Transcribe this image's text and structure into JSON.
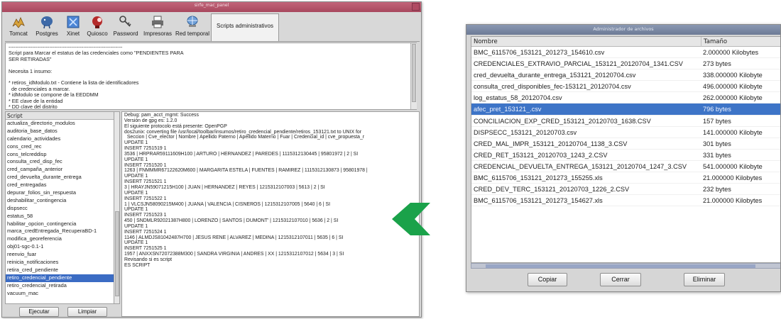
{
  "left_window": {
    "title": "sirfe_mac_panel",
    "tabs": [
      {
        "label": "Tomcat",
        "icon": "tomcat-icon"
      },
      {
        "label": "Postgres",
        "icon": "postgres-elephant-icon"
      },
      {
        "label": "Xinet",
        "icon": "xinet-icon"
      },
      {
        "label": "Quiosco",
        "icon": "quiosco-icon"
      },
      {
        "label": "Password",
        "icon": "key-icon"
      },
      {
        "label": "Impresoras",
        "icon": "printer-icon"
      },
      {
        "label": "Red temporal",
        "icon": "network-icon"
      },
      {
        "label": "Scripts administrativos",
        "icon": ""
      }
    ],
    "description_lines": [
      "-------------------------------------------------------------------",
      "Script para Marcar el estatus de las credenciales como \"PENDIENTES PARA",
      "SER RETIRADAS\"",
      "",
      "Necesita 1 insumo:",
      "",
      "* retiros_idModulo.txt - Contiene la lista de identificadores",
      "  de credenciales a marcar.",
      "* idModulo se compone de la EEDDMM",
      "* EE clave de la entidad",
      "* DD clave del distrito",
      "* MM clave del modulo"
    ],
    "script_list_header": "Script",
    "scripts": [
      "actualiza_directorio_modulos",
      "auditoria_base_datos",
      "calendario_actividades",
      "cons_cred_rec",
      "cons_telcreddisp",
      "consulta_cred_disp_fec",
      "cred_campaña_anterior",
      "cred_devuelta_durante_entrega",
      "cred_entregadas",
      "depurar_folios_sin_respuesta",
      "deshabilitar_contingencia",
      "dispsecc",
      "estatus_58",
      "habilitar_opcion_contingencia",
      "marca_credEntregada_RecuperaBD-1",
      "modifica_georeferencia",
      "obj01-sgc-0.1-1",
      "reenvio_fuar",
      "reinicia_notificaciones",
      "retira_cred_pendiente",
      "retiro_credencial_pendiente",
      "retiro_credencial_retirada",
      "vacuum_mac"
    ],
    "selected_script_index": 20,
    "log_lines": [
      "Debug: pam_acct_mgmt: Success",
      "Versión de gpg es: 1.2.0",
      "El siguiente protocolo está presente: OpenPGP",
      "dos2unix: converting file /usr/local/toolbar/insumos/retiro_credencial_pendiente/retiros_153121.txt to UNIX for",
      "  Seccion | Cve_elector | Nombre | Apellido Paterno | Apellido Materno | Fuar | Credencial_id | cve_propuesta_r",
      "UPDATE 1",
      "INSERT 7251519 1",
      "3536 | HRPRAR59111609H100 | ARTURO | HERNANDEZ | PAREDES | 1115312130445 | 95801972 | 2 | SI",
      "UPDATE 1",
      "INSERT 7251520 1",
      "1263 | FNMMMR67122620M600 | MARGARITA ESTELA | FUENTES | RAMIREZ | 1115312130873 | 95801978 |",
      "UPDATE 1",
      "INSERT 7251521 1",
      "3 | HRAYJN59071215H100 | JUAN | HERNANDEZ | REYES | 1215312107003 | 5613 | 2 | SI",
      "UPDATE 1",
      "INSERT 7251522 1",
      "1 | VLCSJN58090215M400 | JUANA | VALENCIA | CISNEROS | 1215312107005 | 5640 | 6 | SI",
      "UPDATE 1",
      "INSERT 7251523 1",
      "450 | SNDMLR92021387H800 | LORENZO | SANTOS | DUMONT' | 1215312107010 | 5636 | 2 | SI",
      "UPDATE 1",
      "INSERT 7251524 1",
      "1146 | ALMDJS81042487H700 | JESUS RENE | ALVAREZ | MEDINA | 1215312107011 | 5635 | 6 | SI",
      "UPDATE 1",
      "INSERT 7251525 1",
      "1957 | ANXXSN72072388M300 | SANDRA VIRGINIA | ANDRES | XX | 1215312107012 | 5634 | 3 | SI",
      "Revisando si es script",
      "ES SCRIPT"
    ],
    "execute_button": "Ejecutar",
    "clear_button": "Limpiar"
  },
  "right_window": {
    "title": "Administrador de archivos",
    "columns": {
      "name": "Nombre",
      "size": "Tamaño"
    },
    "files": [
      {
        "name": "BMC_6115706_153121_201273_154610.csv",
        "size": "2.000000 Kilobytes"
      },
      {
        "name": "CREDENCIALES_EXTRAVIO_PARCIAL_153121_20120704_1341.CSV",
        "size": "273 bytes"
      },
      {
        "name": "cred_devuelta_durante_entrega_153121_20120704.csv",
        "size": "338.000000 Kilobyte"
      },
      {
        "name": "consulta_cred_disponibles_fec-153121_20120704.csv",
        "size": "496.000000 Kilobyte"
      },
      {
        "name": "log_estatus_58_20120704.csv",
        "size": "262.000000 Kilobyte"
      },
      {
        "name": "afec_pret_153121_.csv",
        "size": "796 bytes"
      },
      {
        "name": "CONCILIACION_EXP_CRED_153121_20120703_1638.CSV",
        "size": "157 bytes"
      },
      {
        "name": "DISPSECC_153121_20120703.csv",
        "size": "141.000000 Kilobyte"
      },
      {
        "name": "CRED_MAL_IMPR_153121_20120704_1138_3.CSV",
        "size": "301 bytes"
      },
      {
        "name": "CRED_RET_153121_20120703_1243_2.CSV",
        "size": "331 bytes"
      },
      {
        "name": "CREDENCIAL_DEVUELTA_ENTREGA_153121_20120704_1247_3.CSV",
        "size": "541.000000 Kilobyte"
      },
      {
        "name": "BMC_6115706_153121_201273_155255.xls",
        "size": "21.000000 Kilobytes"
      },
      {
        "name": "CRED_DEV_TERC_153121_20120703_1226_2.CSV",
        "size": "232 bytes"
      },
      {
        "name": "BMC_6115706_153121_201273_154627.xls",
        "size": "21.000000 Kilobytes"
      }
    ],
    "selected_file_index": 5,
    "copy_button": "Copiar",
    "close_button": "Cerrar",
    "delete_button": "Eliminar"
  },
  "colors": {
    "arrow_green": "#1aa24a",
    "selection_blue": "#3d74c7"
  }
}
